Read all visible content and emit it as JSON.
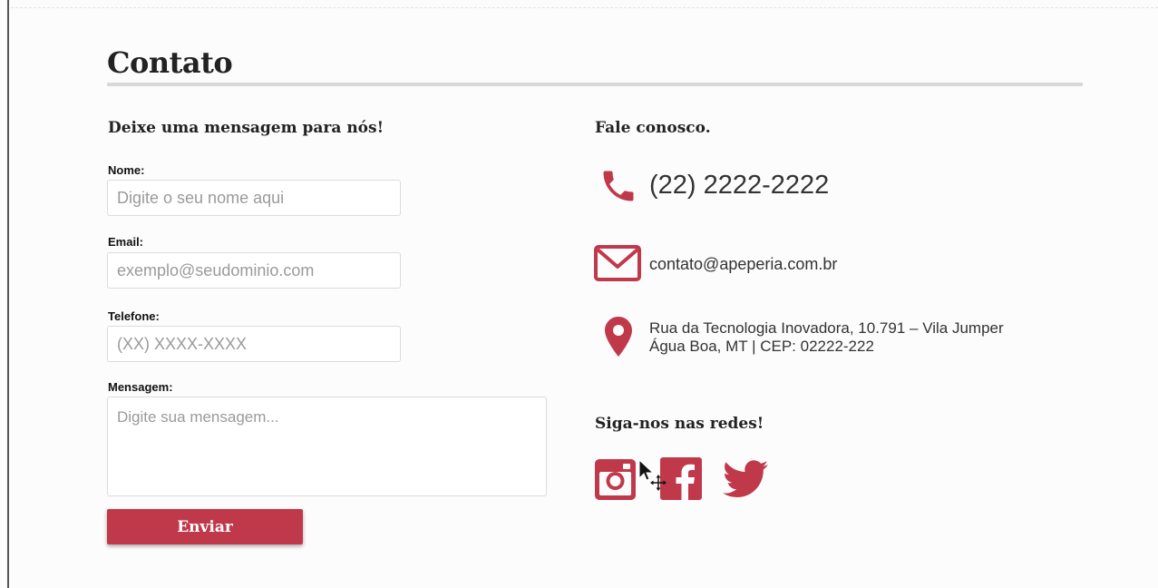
{
  "page": {
    "title": "Contato"
  },
  "form": {
    "heading": "Deixe uma mensagem para nós!",
    "name_label": "Nome:",
    "name_placeholder": "Digite o seu nome aqui",
    "name_value": "",
    "email_label": "Email:",
    "email_placeholder": "exemplo@seudominio.com",
    "email_value": "",
    "phone_label": "Telefone:",
    "phone_placeholder": "(XX) XXXX-XXXX",
    "phone_value": "",
    "message_label": "Mensagem:",
    "message_placeholder": "Digite sua mensagem...",
    "message_value": "",
    "submit_label": "Enviar"
  },
  "contact": {
    "heading": "Fale conosco.",
    "phone": "(22) 2222-2222",
    "email": "contato@apeperia.com.br",
    "address_line1": "Rua da Tecnologia Inovadora, 10.791 – Vila Jumper",
    "address_line2": "Água Boa, MT | CEP: 02222-222",
    "phone_icon": "phone-icon",
    "email_icon": "envelope-icon",
    "address_icon": "map-pin-icon"
  },
  "social": {
    "heading": "Siga-nos nas redes!",
    "networks": [
      {
        "name": "Instagram",
        "icon": "instagram-icon"
      },
      {
        "name": "Facebook",
        "icon": "facebook-icon"
      },
      {
        "name": "Twitter",
        "icon": "twitter-icon"
      }
    ]
  },
  "colors": {
    "accent": "#c0394b",
    "text": "#222222",
    "rule": "#d8d8d8",
    "input_border": "#dcdcdc"
  }
}
